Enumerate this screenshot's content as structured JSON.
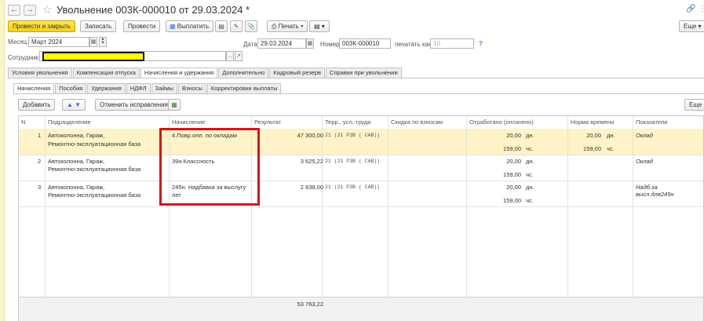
{
  "window": {
    "title": "Увольнение 003К-000010 от 29.03.2024 *",
    "back_icon": "←",
    "forward_icon": "→",
    "star_icon": "☆",
    "link_icon": "🔗",
    "more_icon": "⋮"
  },
  "toolbar": {
    "post_close": "Провести и закрыть",
    "save": "Записать",
    "post": "Провести",
    "pay": "Выплатить",
    "print": "Печать",
    "more": "Еще"
  },
  "header": {
    "month_label": "Месяц:",
    "month_value": "Март 2024",
    "date_label": "Дата:",
    "date_value": "29.03.2024",
    "number_label": "Номер:",
    "number_value": "003К-000010",
    "print_as_label": "печатать как:",
    "print_as_value": "10",
    "help": "?",
    "employee_label": "Сотрудник:",
    "employee_value": ""
  },
  "tabs": [
    "Условия увольнения",
    "Компенсации отпуска",
    "Начисления и удержания",
    "Дополнительно",
    "Кадровый резерв",
    "Справки при увольнении"
  ],
  "subtabs": [
    "Начисления",
    "Пособия",
    "Удержания",
    "НДФЛ",
    "Займы",
    "Взносы",
    "Корректировки выплаты"
  ],
  "grid_toolbar": {
    "add": "Добавить",
    "up": "🡅",
    "down": "🡇",
    "cancel_fix": "Отменить исправления",
    "more": "Еще"
  },
  "columns": {
    "n": "N",
    "division": "Подразделение",
    "accrual": "Начисление",
    "result": "Результат",
    "territory": "Терр., усл. труда",
    "discount": "Скидка по взносам",
    "worked": "Отработано (оплачено)",
    "norm": "Норма времени",
    "indicators": "Показатели"
  },
  "rows": [
    {
      "n": "1",
      "division_1": "Автоколонна, Гараж,",
      "division_2": "Ремонтно-эксплуатационная база",
      "accrual_1": "4.Повр.опл. по окладам",
      "accrual_2": "",
      "result": "47 300,00",
      "territory": "21 (21 РЗВ ( САВ))",
      "worked_days": "20,00",
      "days_unit": "дн.",
      "worked_hours": "159,00",
      "hours_unit": "чс.",
      "norm_days": "20,00",
      "norm_days_unit": "дн.",
      "norm_hours": "159,00",
      "norm_hours_unit": "чс.",
      "indicator_1": "Оклад",
      "indicator_2": ""
    },
    {
      "n": "2",
      "division_1": "Автоколонна, Гараж,",
      "division_2": "Ремонтно-эксплуатационная база",
      "accrual_1": "39н.Классность",
      "accrual_2": "",
      "result": "3 625,22",
      "territory": "21 (21 РЗВ ( САВ))",
      "worked_days": "20,00",
      "days_unit": "дн.",
      "worked_hours": "159,00",
      "hours_unit": "чс.",
      "indicator_1": "Оклад",
      "indicator_2": ""
    },
    {
      "n": "3",
      "division_1": "Автоколонна, Гараж,",
      "division_2": "Ремонтно-эксплуатационная база",
      "accrual_1": "245н. Надбавка за выслугу",
      "accrual_2": "лет",
      "result": "2 838,00",
      "territory": "21 (21 РЗВ ( САВ))",
      "worked_days": "20,00",
      "days_unit": "дн.",
      "worked_hours": "159,00",
      "hours_unit": "чс.",
      "indicator_1": "Надб.за",
      "indicator_2": "высл.для245н"
    }
  ],
  "totals": {
    "result": "53 763,22"
  },
  "colors": {
    "primary_button": "#f5cf16",
    "selected_row": "#fff3c7",
    "highlight_border": "#d4151b",
    "redaction": "#ffff00"
  }
}
